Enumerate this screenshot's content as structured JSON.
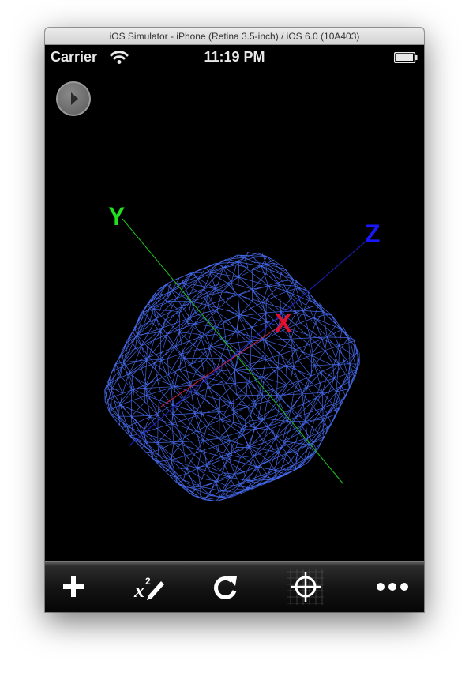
{
  "window": {
    "title": "iOS Simulator - iPhone (Retina 3.5-inch) / iOS 6.0 (10A403)"
  },
  "status_bar": {
    "carrier": "Carrier",
    "time": "11:19 PM"
  },
  "scene": {
    "axes": [
      {
        "label": "Y",
        "color": "#20e020"
      },
      {
        "label": "Z",
        "color": "#1818ff"
      },
      {
        "label": "X",
        "color": "#e01030"
      }
    ],
    "mesh_color": "#4a72ff"
  },
  "toolbar": {
    "buttons": [
      {
        "name": "add-button",
        "icon": "plus-icon"
      },
      {
        "name": "formula-edit-button",
        "icon": "x-squared-pencil-icon"
      },
      {
        "name": "reset-rotation-button",
        "icon": "rotate-icon"
      },
      {
        "name": "center-view-button",
        "icon": "crosshair-grid-icon"
      },
      {
        "name": "more-button",
        "icon": "ellipsis-icon"
      }
    ]
  }
}
